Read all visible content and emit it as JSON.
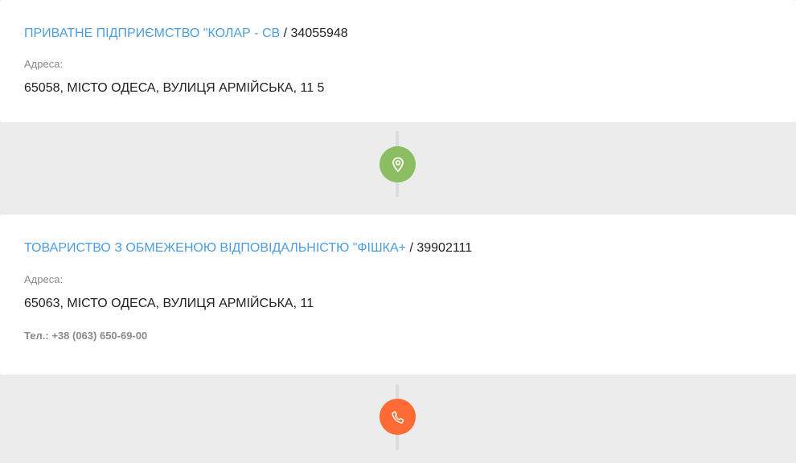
{
  "cards": [
    {
      "company_name": "ПРИВАТНЕ ПІДПРИЄМСТВО \"КОЛАР - СВ",
      "separator": " / ",
      "code": "34055948",
      "address_label": "Адреса:",
      "address": "65058, МІСТО ОДЕСА, ВУЛИЦЯ АРМІЙСЬКА, 11 5"
    },
    {
      "company_name": "ТОВАРИСТВО З ОБМЕЖЕНОЮ ВІДПОВІДАЛЬНІСТЮ \"ФІШКА+",
      "separator": " / ",
      "code": "39902111",
      "address_label": "Адреса:",
      "address": "65063, МІСТО ОДЕСА, ВУЛИЦЯ АРМІЙСЬКА, 11",
      "phone": "Тел.: +38 (063) 650-69-00"
    }
  ],
  "connectors": [
    {
      "icon": "location-pin-icon",
      "color": "#8bbd63"
    },
    {
      "icon": "phone-icon",
      "color": "#ff6b35"
    }
  ],
  "colors": {
    "link": "#4a9ee0",
    "background": "#ececec",
    "card": "#ffffff"
  }
}
